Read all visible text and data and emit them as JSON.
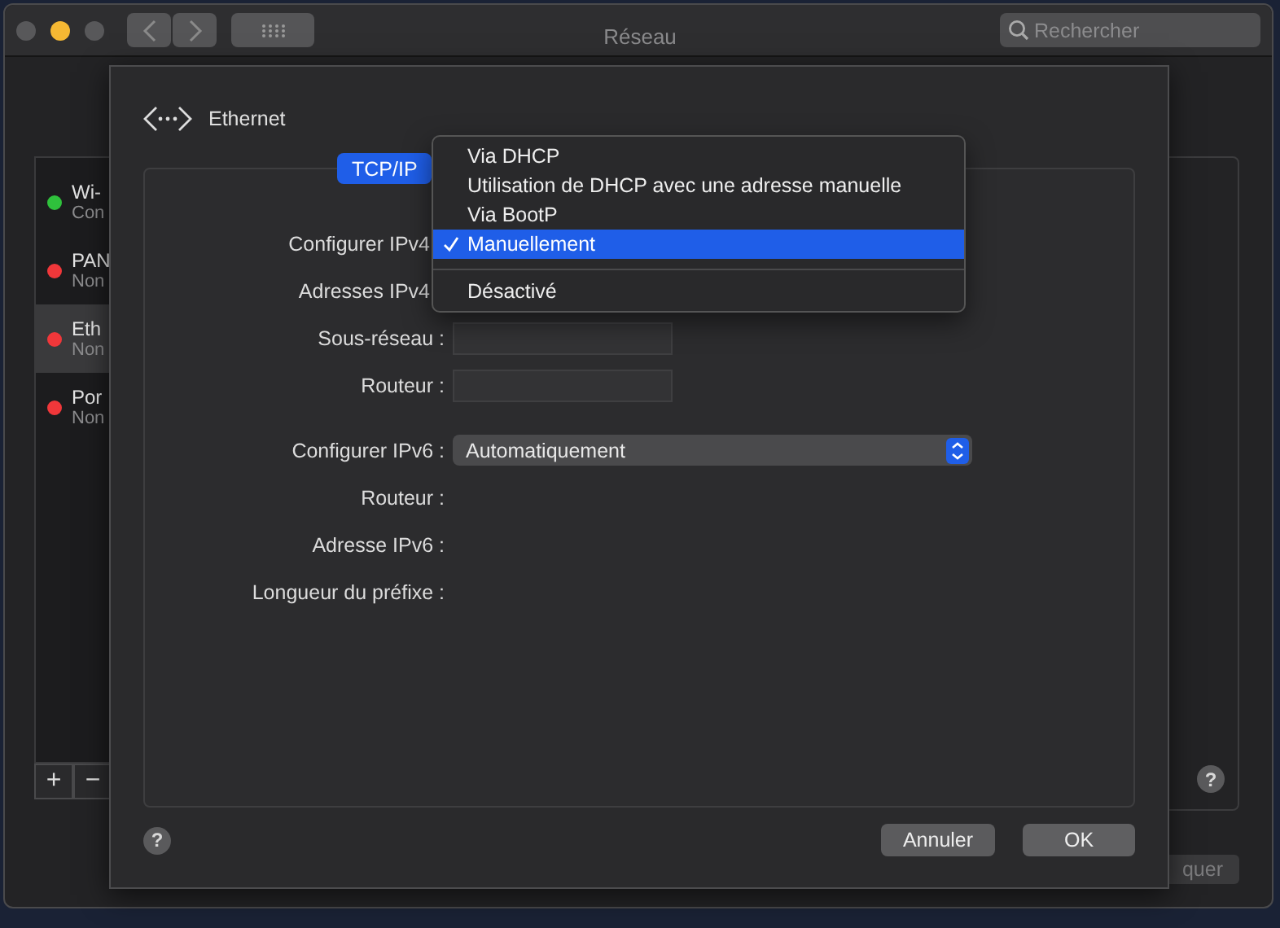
{
  "window": {
    "title": "Réseau",
    "search": {
      "placeholder": "Rechercher"
    }
  },
  "services": [
    {
      "name": "Wi-",
      "status": "Con",
      "color": "#2fc13c",
      "selected": false
    },
    {
      "name": "PAN",
      "status": "Non",
      "color": "#f0373a",
      "selected": false
    },
    {
      "name": "Eth",
      "status": "Non",
      "color": "#f0373a",
      "selected": true
    },
    {
      "name": "Por",
      "status": "Non",
      "color": "#f0373a",
      "selected": false
    }
  ],
  "sidebar_buttons": [
    "+",
    "−"
  ],
  "apply_button": "quer",
  "help_button": "?",
  "sheet": {
    "header": "Ethernet",
    "tabs": [
      {
        "label": "TCP/IP",
        "selected": true
      }
    ],
    "groups": [
      {
        "rows": [
          {
            "kind": "covered",
            "label": "Configurer IPv4"
          },
          {
            "kind": "covered",
            "label": "Adresses IPv4"
          },
          {
            "kind": "field",
            "label": "Sous-réseau :"
          },
          {
            "kind": "field",
            "label": "Routeur :"
          }
        ]
      },
      {
        "rows": [
          {
            "kind": "popup",
            "label": "Configurer IPv6 :",
            "value": "Automatiquement"
          },
          {
            "kind": "label",
            "label": "Routeur :"
          },
          {
            "kind": "label",
            "label": "Adresse IPv6 :"
          },
          {
            "kind": "label",
            "label": "Longueur du préfixe :"
          }
        ]
      }
    ],
    "help_button": "?",
    "buttons": [
      {
        "label": "Annuler",
        "kind": "cancel"
      },
      {
        "label": "OK",
        "kind": "default"
      }
    ]
  },
  "menu": {
    "items": [
      {
        "kind": "item",
        "label": "Via DHCP",
        "checked": false,
        "selected": false
      },
      {
        "kind": "item",
        "label": "Utilisation de DHCP avec une adresse manuelle",
        "checked": false,
        "selected": false
      },
      {
        "kind": "item",
        "label": "Via BootP",
        "checked": false,
        "selected": false
      },
      {
        "kind": "item",
        "label": "Manuellement",
        "checked": true,
        "selected": true
      },
      {
        "kind": "separator"
      },
      {
        "kind": "item",
        "label": "Désactivé",
        "checked": false,
        "selected": false
      }
    ]
  }
}
